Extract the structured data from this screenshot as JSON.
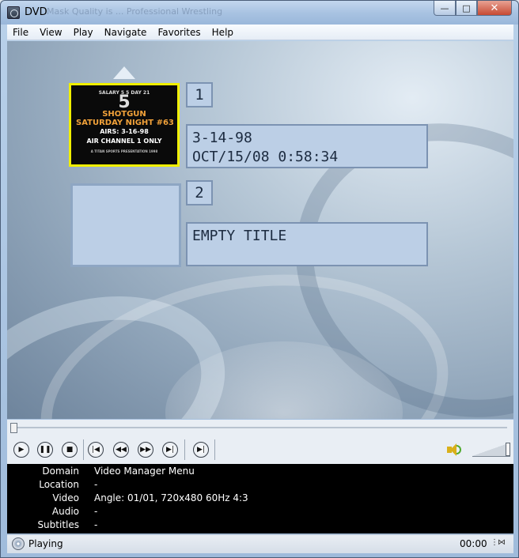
{
  "window": {
    "title": "DVD",
    "background_title_ghost": "Mask Quality is ... Professional Wrestling",
    "minimize_symbol": "—",
    "maximize_symbol": "□",
    "close_symbol": "✕"
  },
  "menu": {
    "items": [
      "File",
      "View",
      "Play",
      "Navigate",
      "Favorites",
      "Help"
    ]
  },
  "dvd_menu": {
    "titles": [
      {
        "number": "1",
        "line1": "3-14-98",
        "line2": "OCT/15/08 0:58:34",
        "thumbnail": {
          "small_top": "SALARY 5  5 DAY 21",
          "big": "5",
          "line1": "SHOTGUN",
          "line2": "SATURDAY NIGHT #63",
          "line3": "AIRS: 3-16-98",
          "line4": "AIR CHANNEL 1 ONLY",
          "tiny": "A TITAN SPORTS PRESENTATION 1998"
        }
      },
      {
        "number": "2",
        "line1": "EMPTY TITLE",
        "line2": ""
      }
    ],
    "up_arrow_icon": "triangle-up-icon"
  },
  "controls": {
    "seek_position": 0,
    "buttons": [
      {
        "name": "play-button",
        "icon": "play-icon",
        "glyph": "▶"
      },
      {
        "name": "pause-button",
        "icon": "pause-icon",
        "glyph": "❚❚"
      },
      {
        "name": "stop-button",
        "icon": "stop-icon",
        "glyph": "■"
      },
      {
        "name": "previous-button",
        "icon": "skip-back-icon",
        "glyph": "|◀"
      },
      {
        "name": "rewind-button",
        "icon": "rewind-icon",
        "glyph": "◀◀"
      },
      {
        "name": "fast-forward-button",
        "icon": "fast-forward-icon",
        "glyph": "▶▶"
      },
      {
        "name": "next-button",
        "icon": "skip-forward-icon",
        "glyph": "▶|"
      },
      {
        "name": "step-frame-button",
        "icon": "step-icon",
        "glyph": "▶|"
      }
    ],
    "volume_icon": "speaker-icon",
    "volume_level": 1.0
  },
  "status_panel": {
    "rows": [
      {
        "label": "Domain",
        "value": "Video Manager Menu"
      },
      {
        "label": "Location",
        "value": "-"
      },
      {
        "label": "Video",
        "value": "Angle: 01/01, 720x480 60Hz 4:3"
      },
      {
        "label": "Audio",
        "value": "-"
      },
      {
        "label": "Subtitles",
        "value": "-"
      }
    ]
  },
  "statusbar": {
    "status": "Playing",
    "time": "00:00",
    "resize_glyph": "⋮⋈"
  },
  "colors": {
    "selection_border": "#f0ef00",
    "menu_box_fill": "#bccfe6",
    "panel_bg": "#000000"
  }
}
